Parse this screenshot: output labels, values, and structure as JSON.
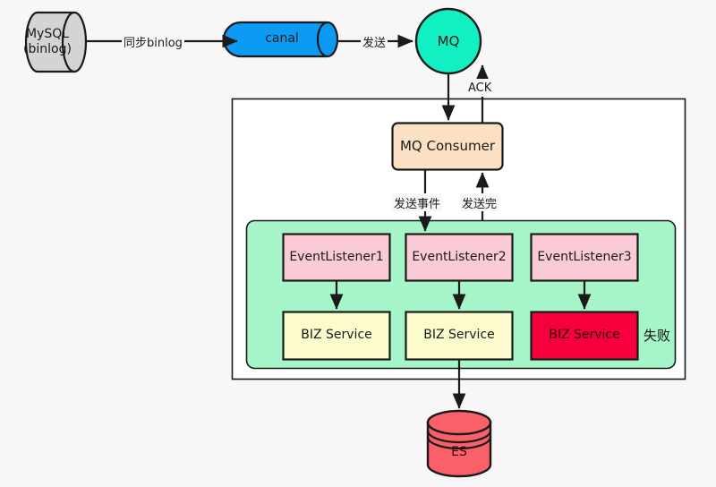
{
  "diagram": {
    "title": "binlog sync to ES event pipeline",
    "colors": {
      "mysql_fill": "#D4D4D4",
      "canal_fill": "#0C9AF2",
      "mq_fill": "#12EFC2",
      "consumer_fill": "#FBE0C4",
      "listener_fill": "#FACBD4",
      "biz_fill": "#FBFBCD",
      "biz_failed_fill": "#F5003C",
      "group_fill": "#A5F5C8",
      "container_fill": "#FFFFFF",
      "es_fill": "#FA6068",
      "stroke": "#1A1A1A",
      "text": "#1A1A1A"
    },
    "nodes": {
      "mysql": {
        "label": "MySQL\n(binlog)",
        "shape": "cylinder-horizontal"
      },
      "canal": {
        "label": "canal",
        "shape": "cylinder-horizontal"
      },
      "mq": {
        "label": "MQ",
        "shape": "circle"
      },
      "mq_consumer": {
        "label": "MQ Consumer",
        "shape": "rounded-rect"
      },
      "listener1": {
        "label": "EventListener1",
        "shape": "rect"
      },
      "listener2": {
        "label": "EventListener2",
        "shape": "rect"
      },
      "listener3": {
        "label": "EventListener3",
        "shape": "rect"
      },
      "biz1": {
        "label": "BIZ Service",
        "shape": "rect"
      },
      "biz2": {
        "label": "BIZ Service",
        "shape": "rect"
      },
      "biz3": {
        "label": "BIZ Service",
        "shape": "rect"
      },
      "es": {
        "label": "ES",
        "shape": "cylinder-vertical"
      }
    },
    "edges": [
      {
        "id": "mysql-to-canal",
        "label": "同步binlog"
      },
      {
        "id": "canal-to-mq",
        "label": "发送"
      },
      {
        "id": "mq-to-consumer",
        "label": ""
      },
      {
        "id": "consumer-to-mq-ack",
        "label": "ACK"
      },
      {
        "id": "consumer-to-listeners",
        "label": "发送事件"
      },
      {
        "id": "listeners-to-consumer",
        "label": "发送完"
      },
      {
        "id": "listener1-to-biz1",
        "label": ""
      },
      {
        "id": "listener2-to-biz2",
        "label": ""
      },
      {
        "id": "listener3-to-biz3",
        "label": ""
      },
      {
        "id": "biz2-to-es",
        "label": ""
      }
    ],
    "annotations": {
      "failure": "失败"
    }
  }
}
